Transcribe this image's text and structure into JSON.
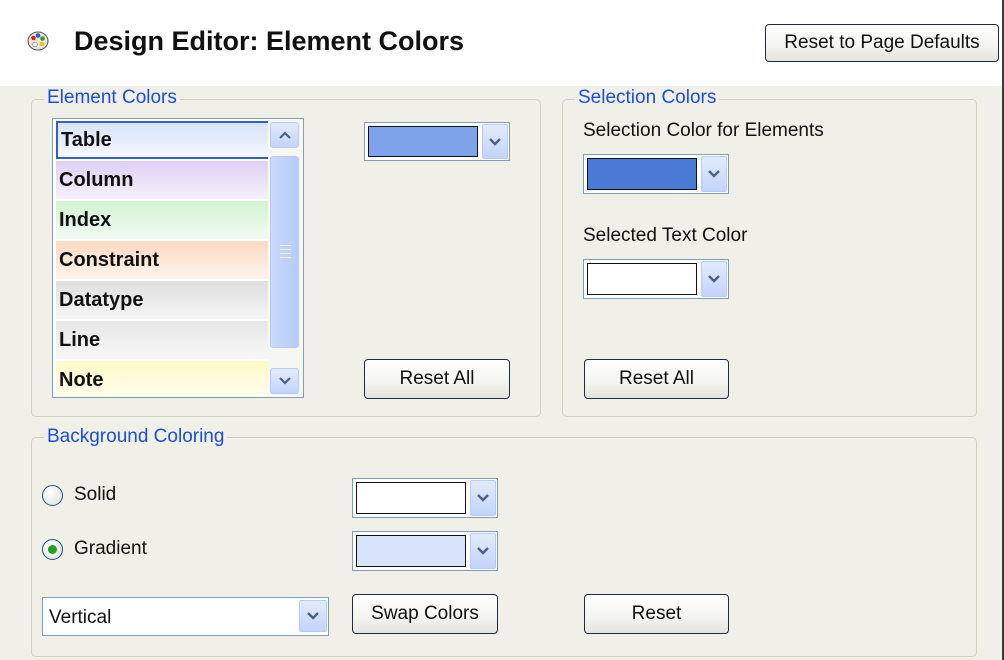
{
  "header": {
    "title": "Design Editor: Element Colors",
    "reset_page_defaults_label": "Reset to Page Defaults",
    "icon": "palette-icon"
  },
  "element_colors": {
    "legend": "Element Colors",
    "items": [
      {
        "label": "Table",
        "color": "#d8e4fb",
        "selected": true
      },
      {
        "label": "Column",
        "color": "#ddd0f5"
      },
      {
        "label": "Index",
        "color": "#d2f2d2"
      },
      {
        "label": "Constraint",
        "color": "#fbd9c2"
      },
      {
        "label": "Datatype",
        "color": "#dedede"
      },
      {
        "label": "Line",
        "color": "#e6e6e6"
      },
      {
        "label": "Note",
        "color": "#fdfbc6"
      }
    ],
    "current_color": "#7fa3ea",
    "reset_all_label": "Reset All"
  },
  "selection_colors": {
    "legend": "Selection Colors",
    "element_label": "Selection Color for Elements",
    "element_color": "#4a7ad6",
    "text_label": "Selected Text Color",
    "text_color": "#ffffff",
    "reset_all_label": "Reset All"
  },
  "background": {
    "legend": "Background Coloring",
    "solid_label": "Solid",
    "solid_color": "#ffffff",
    "gradient_label": "Gradient",
    "gradient_color": "#d8e4fb",
    "mode": "gradient",
    "direction": "Vertical",
    "swap_label": "Swap Colors",
    "reset_label": "Reset"
  }
}
